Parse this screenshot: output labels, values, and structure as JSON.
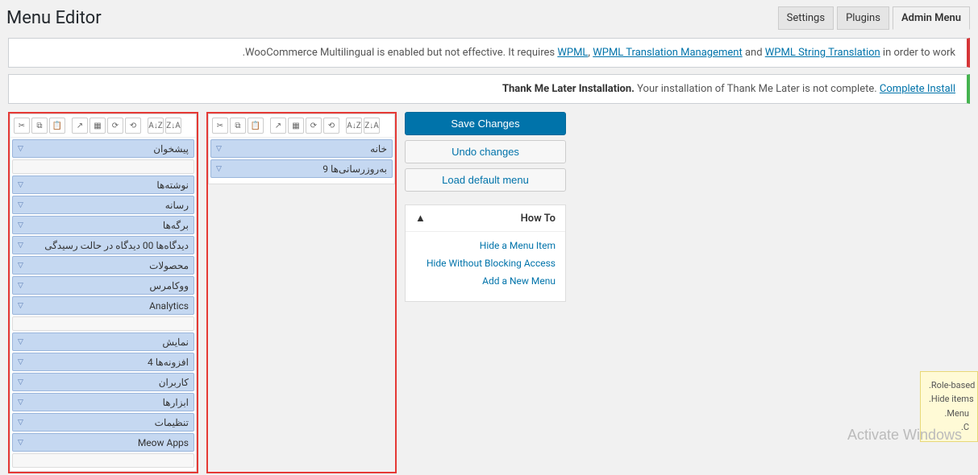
{
  "header": {
    "title": "Menu Editor"
  },
  "tabs": [
    {
      "label": "Settings"
    },
    {
      "label": "Plugins"
    },
    {
      "label": "Admin Menu",
      "active": true
    }
  ],
  "notice1": {
    "prefix": ".",
    "text1": "WooCommerce Multilingual is enabled but not effective. It requires ",
    "link1": "WPML",
    "sep1": ", ",
    "link2": "WPML Translation Management",
    "sep2": " and ",
    "link3": "WPML String Translation",
    "suffix": " in order to work"
  },
  "notice2": {
    "strong": "Thank Me Later Installation.",
    "text": " Your installation of Thank Me Later is not complete. ",
    "link": "Complete Install"
  },
  "toolbar_icons": [
    "✂",
    "⧉",
    "📋",
    "",
    "↗",
    "▦",
    "⟳",
    "⟲",
    "A↓Z",
    "Z↓A"
  ],
  "col1": [
    {
      "label": "پیشخوان"
    },
    {
      "sep": true
    },
    {
      "label": "نوشته‌ها"
    },
    {
      "label": "رسانه"
    },
    {
      "label": "برگه‌ها"
    },
    {
      "label": "دیدگاه‌ها 00 دیدگاه در حالت رسیدگی"
    },
    {
      "label": "محصولات"
    },
    {
      "label": "ووکامرس"
    },
    {
      "label": "Analytics"
    },
    {
      "sep": true
    },
    {
      "label": "نمایش"
    },
    {
      "label": "افزونه‌ها 4"
    },
    {
      "label": "کاربران"
    },
    {
      "label": "ابزارها"
    },
    {
      "label": "تنظیمات"
    },
    {
      "label": "Meow Apps"
    },
    {
      "sep": true
    }
  ],
  "col2": [
    {
      "label": "خانه"
    },
    {
      "label": "به‌روزرسانی‌ها 9"
    }
  ],
  "buttons": {
    "save": "Save Changes",
    "undo": "Undo changes",
    "load": "Load default menu"
  },
  "howto": {
    "title": "How To",
    "toggle": "▲",
    "links": [
      "Hide a Menu Item",
      "Hide Without Blocking Access",
      "Add a New Menu"
    ]
  },
  "upgrade": {
    "l1": ".Role-based",
    "l2": ".Hide items",
    "l3": ".Menu",
    "l4": ".C"
  },
  "activate": {
    "title": "Activate Windows",
    "sub": ""
  }
}
